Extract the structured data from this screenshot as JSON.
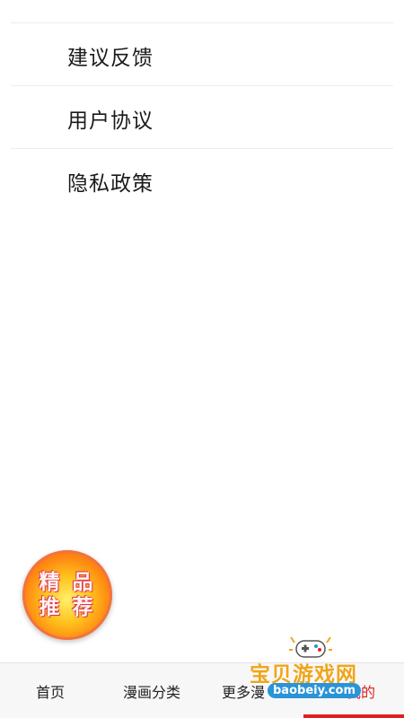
{
  "menu": {
    "items": [
      {
        "label": "建议反馈"
      },
      {
        "label": "用户协议"
      },
      {
        "label": "隐私政策"
      }
    ]
  },
  "promo_badge": {
    "line1": "精 品",
    "line2": "推 荐"
  },
  "tabbar": {
    "tabs": [
      {
        "label": "首页"
      },
      {
        "label": "漫画分类"
      },
      {
        "label": "更多漫"
      },
      {
        "label": "我的"
      }
    ],
    "active_index": 3,
    "accent_color": "#e02020"
  },
  "watermark": {
    "title": "宝贝游戏网",
    "url": "baobeiy.com",
    "icon": "gamepad-icon"
  }
}
